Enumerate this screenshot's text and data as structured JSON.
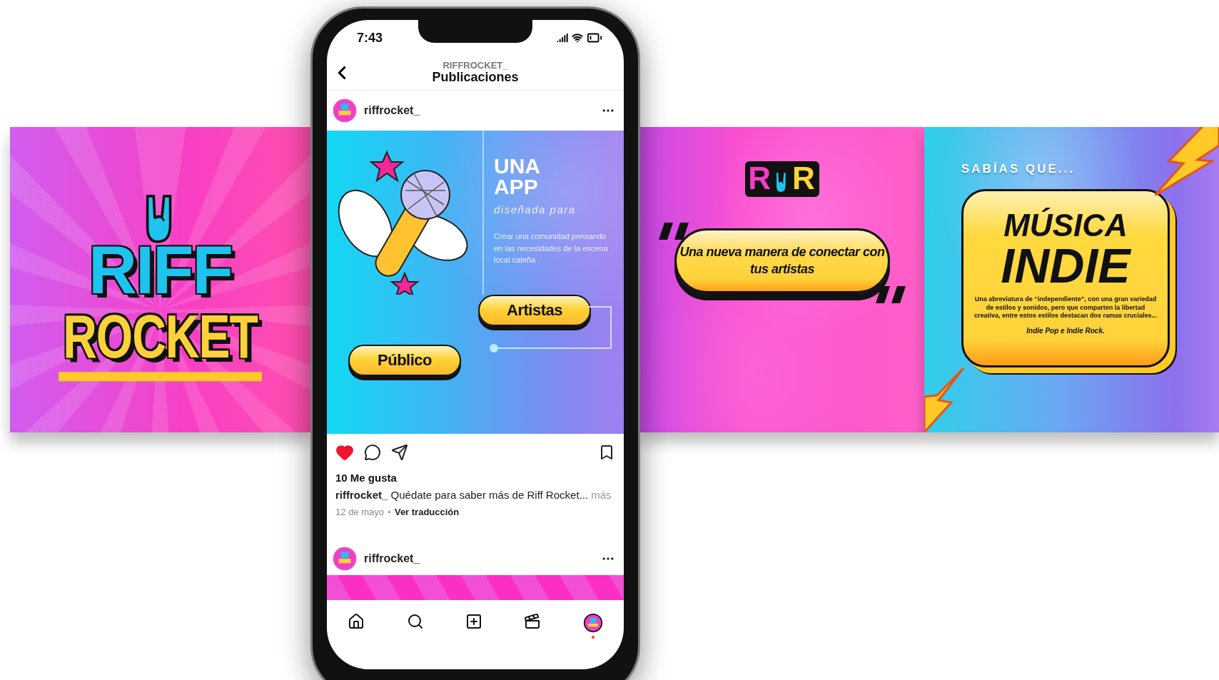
{
  "banner": {
    "logo_panel": {
      "line_1": "RIFF",
      "line_2": "ROCKET"
    },
    "quote_panel": {
      "logo_left": "R",
      "logo_right": "R",
      "quote": "Una nueva manera de conectar con tus artistas"
    },
    "fact_panel": {
      "kicker": "SABÍAS QUE...",
      "title_1": "MÚSICA",
      "title_2": "INDIE",
      "body": "Una abreviatura de “independiente”, con una gran variedad de estilos y sonidos, pero que comparten la libertad creativa, entre estos estilos destacan dos ramas cruciales...",
      "footer": "Indie Pop e Indie Rock."
    }
  },
  "phone": {
    "status_bar": {
      "time": "7:43"
    },
    "header": {
      "account": "RIFFROCKET_",
      "title": "Publicaciones"
    },
    "posts": [
      {
        "username": "riffrocket_",
        "slide": {
          "title_1": "UNA",
          "title_2": "APP",
          "subtitle": "diseñada para",
          "body": "Crear una comunidad pensando en las necesidades de la escena local caleña .",
          "buttons": [
            "Artistas",
            "Público"
          ]
        },
        "liked": true,
        "likes": "10 Me gusta",
        "caption": "**riffrocket_** Quédate para saber más de Riff Rocket...",
        "more": "más",
        "date": "12 de mayo",
        "translate": "Ver traducción"
      },
      {
        "username": "riffrocket_"
      }
    ],
    "nav": [
      {
        "kind": "home",
        "selected": false
      },
      {
        "kind": "search",
        "selected": false
      },
      {
        "kind": "create",
        "selected": false
      },
      {
        "kind": "reels",
        "selected": false
      },
      {
        "kind": "profile",
        "selected": true
      }
    ]
  }
}
